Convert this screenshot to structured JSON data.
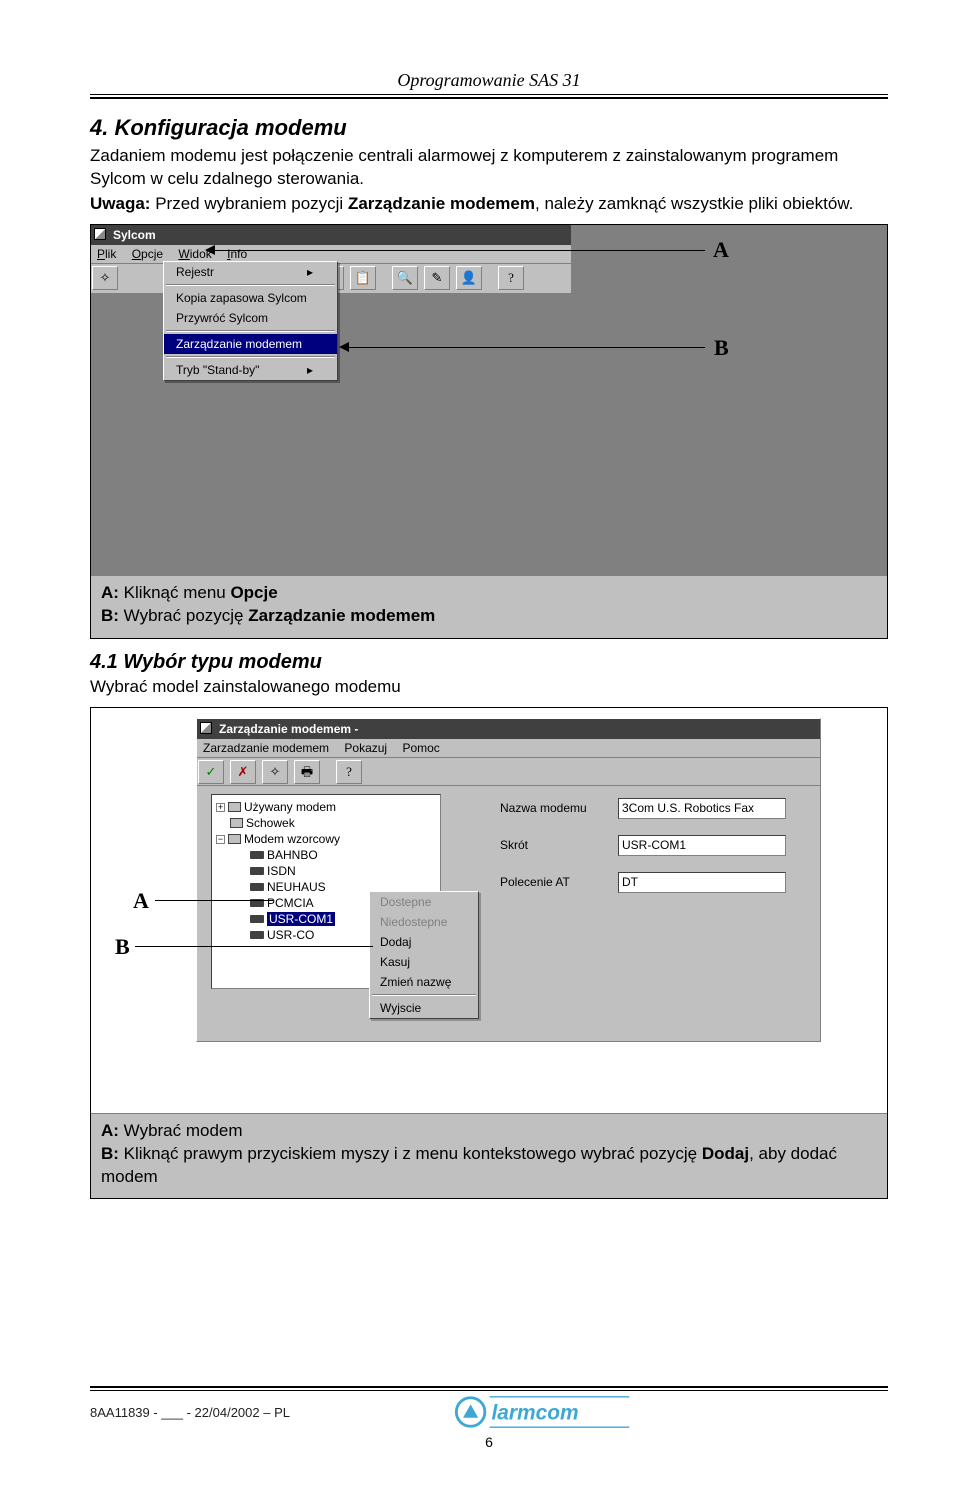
{
  "header": {
    "title": "Oprogramowanie SAS 31"
  },
  "h2": "4. Konfiguracja modemu",
  "intro1": "Zadaniem modemu jest połączenie centrali alarmowej z komputerem z zainstalowanym programem Sylcom w celu zdalnego sterowania.",
  "intro2_prefix": "Uwaga:",
  "intro2a": " Przed wybraniem pozycji ",
  "intro2b": "Zarządzanie modemem",
  "intro2c": ", należy zamknąć wszystkie pliki obiektów.",
  "ss1": {
    "title": "Sylcom",
    "menus": {
      "plik": "Plik",
      "opcje": "Opcje",
      "widok": "Widok",
      "info": "Info"
    },
    "dropdown": [
      "Rejestr",
      "Kopia zapasowa Sylcom",
      "Przywróć Sylcom",
      "Zarządzanie modemem",
      "Tryb \"Stand-by\""
    ],
    "labelA": "A",
    "labelB": "B",
    "caption_a_pre": "A: ",
    "caption_a1": "Kliknąć menu ",
    "caption_a2": "Opcje",
    "caption_b_pre": "B: ",
    "caption_b1": "Wybrać pozycję ",
    "caption_b2": "Zarządzanie modemem"
  },
  "h3": "4.1 Wybór typu modemu",
  "sub1": "Wybrać model zainstalowanego modemu",
  "ss2": {
    "title": "Zarządzanie modemem -",
    "menus": {
      "m1": "Zarzadzanie modemem",
      "m2": "Pokazuj",
      "m3": "Pomoc"
    },
    "tree": {
      "n1": "Używany modem",
      "n2": "Schowek",
      "n3": "Modem wzorcowy",
      "leaves": [
        "BAHNBO",
        "ISDN",
        "NEUHAUS",
        "PCMCIA",
        "USR-COM1",
        "USR-CO"
      ]
    },
    "form": {
      "l1": "Nazwa modemu",
      "v1": "3Com U.S. Robotics Fax",
      "l2": "Skrót",
      "v2": "USR-COM1",
      "l3": "Polecenie AT",
      "v3": "DT"
    },
    "context": [
      "Dostepne",
      "Niedostepne",
      "Dodaj",
      "Kasuj",
      "Zmień nazwę",
      "Wyjscie"
    ],
    "labelA": "A",
    "labelB": "B",
    "caption_a_pre": "A: ",
    "caption_a": "Wybrać modem",
    "caption_b_pre": "B: ",
    "caption_b1": "Kliknąć prawym przyciskiem myszy i z menu kontekstowego wybrać pozycję ",
    "caption_b2": "Dodaj",
    "caption_b3": ", aby dodać modem"
  },
  "footer": {
    "left": "8AA11839 - ___ - 22/04/2002 – PL",
    "pagenum": "6",
    "logo_text": "larmcom"
  }
}
